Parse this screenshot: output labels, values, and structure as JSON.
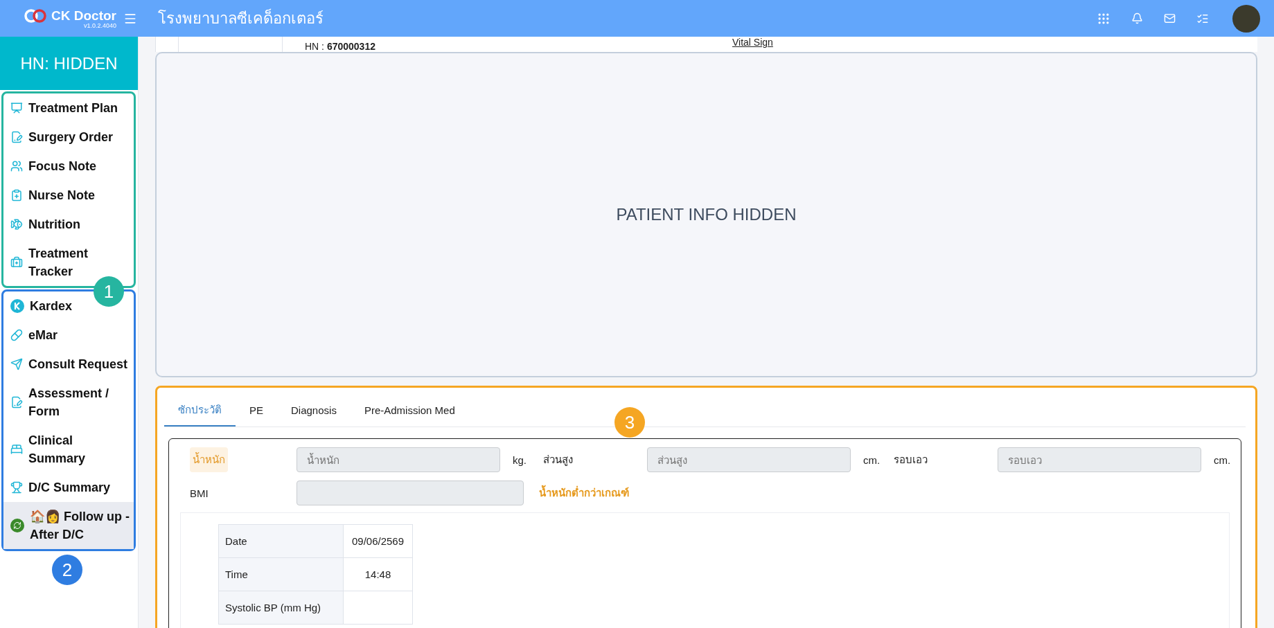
{
  "header": {
    "logo": "CK Doctor",
    "version": "v1.0.2.4040",
    "hospital": "โรงพยาบาลซีเคด็อกเตอร์"
  },
  "sidebar": {
    "hn": "HN: HIDDEN",
    "groups": [
      {
        "badge": "1",
        "color": "#26b5a0",
        "items": [
          {
            "label": "Treatment Plan",
            "selected": false
          },
          {
            "label": "Surgery Order",
            "selected": false
          },
          {
            "label": "Focus Note",
            "selected": false
          },
          {
            "label": "Nurse Note",
            "selected": false
          },
          {
            "label": "Nutrition",
            "selected": false
          },
          {
            "label": "Treatment Tracker",
            "selected": false
          }
        ]
      },
      {
        "badge": "2",
        "color": "#2f7de1",
        "items": [
          {
            "label": "Kardex",
            "selected": false
          },
          {
            "label": "eMar",
            "selected": false
          },
          {
            "label": "Consult Request",
            "selected": false
          },
          {
            "label": "Assessment / Form",
            "selected": false
          },
          {
            "label": "Clinical Summary",
            "selected": false
          },
          {
            "label": "D/C Summary",
            "selected": false
          },
          {
            "label": "🏠👩 Follow up - After D/C",
            "selected": true
          }
        ]
      }
    ]
  },
  "patient": {
    "hn_label": "HN :",
    "hn": "670000312",
    "link": "Vital Sign",
    "overlay": "PATIENT INFO HIDDEN"
  },
  "form": {
    "badge": "3",
    "color": "#f5a623",
    "tabs": [
      {
        "label": "ซักประวัติ",
        "selected": true
      },
      {
        "label": "PE",
        "selected": false
      },
      {
        "label": "Diagnosis",
        "selected": false
      },
      {
        "label": "Pre-Admission Med",
        "selected": false
      }
    ],
    "measurements": [
      {
        "label": "น้ำหนัก",
        "placeholder": "น้ำหนัก",
        "unit": "kg.",
        "highlight": true
      },
      {
        "label": "ส่วนสูง",
        "placeholder": "ส่วนสูง",
        "unit": "cm.",
        "highlight": false
      },
      {
        "label": "รอบเอว",
        "placeholder": "รอบเอว",
        "unit": "cm.",
        "highlight": false
      }
    ],
    "bmi": {
      "label": "BMI",
      "warning": "น้ำหนักต่ำกว่าเกณฑ์"
    },
    "vitals": [
      {
        "label": "Date",
        "value": "09/06/2569"
      },
      {
        "label": "Time",
        "value": "14:48"
      },
      {
        "label": "Systolic BP (mm Hg)"
      }
    ]
  }
}
